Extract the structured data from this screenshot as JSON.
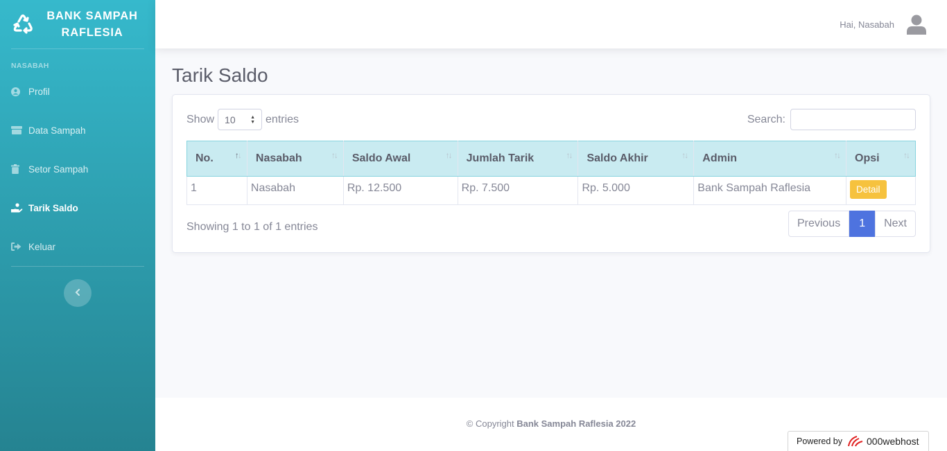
{
  "brand": {
    "line1": "BANK SAMPAH",
    "line2": "RAFLESIA",
    "icon": "recycle-icon"
  },
  "sidebar": {
    "heading": "NASABAH",
    "items": [
      {
        "label": "Profil",
        "icon": "user-circle-icon",
        "active": false
      },
      {
        "label": "Data Sampah",
        "icon": "archive-icon",
        "active": false
      },
      {
        "label": "Setor Sampah",
        "icon": "trash-icon",
        "active": false
      },
      {
        "label": "Tarik Saldo",
        "icon": "hand-holding-icon",
        "active": true
      },
      {
        "label": "Keluar",
        "icon": "sign-out-icon",
        "active": false
      }
    ],
    "toggle_icon": "chevron-left-icon"
  },
  "topbar": {
    "greeting": "Hai, Nasabah",
    "avatar_icon": "user-avatar-icon"
  },
  "page": {
    "title": "Tarik Saldo"
  },
  "table_controls": {
    "show_label": "Show",
    "entries_value": "10",
    "entries_label": "entries",
    "search_label": "Search:",
    "search_value": ""
  },
  "table": {
    "columns": [
      "No.",
      "Nasabah",
      "Saldo Awal",
      "Jumlah Tarik",
      "Saldo Akhir",
      "Admin",
      "Opsi"
    ],
    "rows": [
      {
        "no": "1",
        "nasabah": "Nasabah",
        "saldo_awal": "Rp. 12.500",
        "jumlah_tarik": "Rp. 7.500",
        "saldo_akhir": "Rp. 5.000",
        "admin": "Bank Sampah Raflesia",
        "action": "Detail"
      }
    ]
  },
  "pagination": {
    "info": "Showing 1 to 1 of 1 entries",
    "previous": "Previous",
    "current": "1",
    "next": "Next"
  },
  "footer": {
    "copyright_prefix": "© Copyright",
    "copyright_name": "Bank Sampah Raflesia 2022"
  },
  "powered": {
    "label": "Powered by",
    "host": "000webhost"
  },
  "colors": {
    "sidebar_top": "#36b9cc",
    "sidebar_bottom": "#258391",
    "header_bg": "#c9ebf1",
    "primary": "#4e73df",
    "warning": "#f6c23e"
  }
}
